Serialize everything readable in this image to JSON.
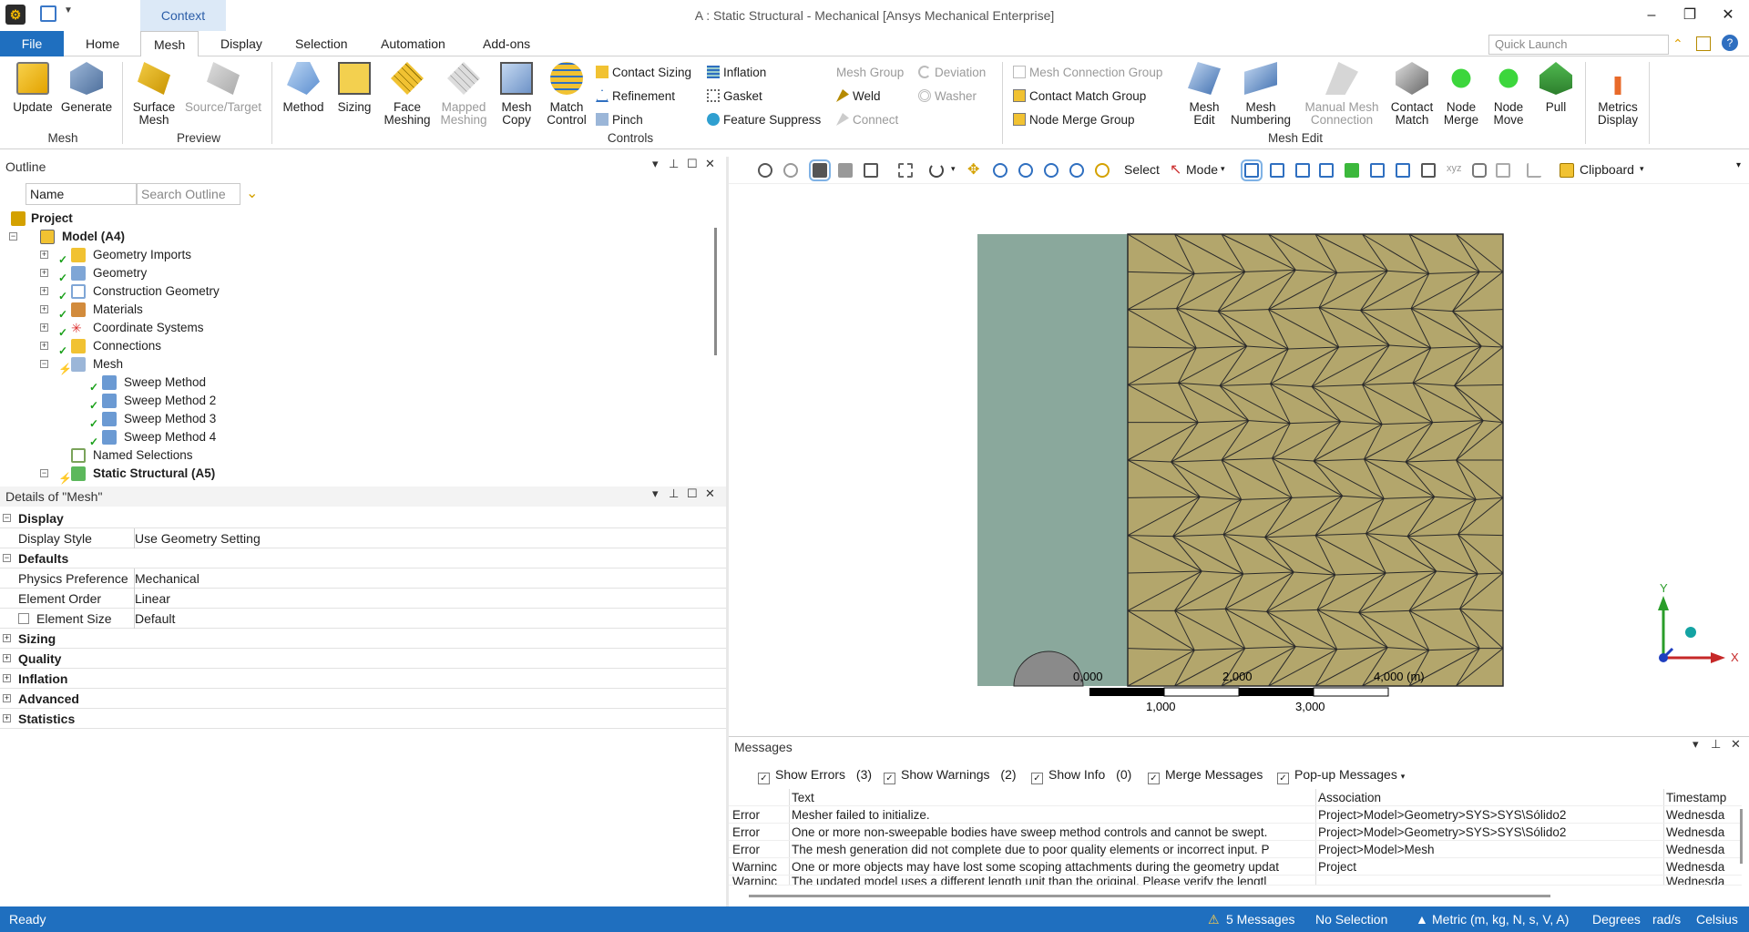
{
  "window": {
    "title": "A : Static Structural - Mechanical [Ansys Mechanical Enterprise]",
    "context_tab": "Context",
    "controls": {
      "minimize": "–",
      "restore": "❐",
      "close": "✕"
    }
  },
  "tabs": {
    "file": "File",
    "home": "Home",
    "mesh": "Mesh",
    "display": "Display",
    "selection": "Selection",
    "automation": "Automation",
    "addons": "Add-ons"
  },
  "quick_launch": {
    "placeholder": "Quick Launch"
  },
  "ribbon": {
    "mesh_group": {
      "label": "Mesh",
      "update": "Update",
      "generate": "Generate"
    },
    "preview_group": {
      "label": "Preview",
      "surface_mesh": "Surface Mesh",
      "source_target": "Source/Target"
    },
    "controls_group": {
      "label": "Controls",
      "method": "Method",
      "sizing": "Sizing",
      "face_meshing": "Face Meshing",
      "mapped_meshing": "Mapped Meshing",
      "mesh_copy": "Mesh Copy",
      "match_control": "Match Control",
      "contact_sizing": "Contact Sizing",
      "refinement": "Refinement",
      "pinch": "Pinch",
      "inflation": "Inflation",
      "gasket": "Gasket",
      "feature_suppress": "Feature Suppress",
      "mesh_group_item": "Mesh Group",
      "weld": "Weld",
      "connect": "Connect",
      "deviation": "Deviation",
      "washer": "Washer"
    },
    "meshedit_group": {
      "label": "Mesh Edit",
      "mesh_connection_group": "Mesh Connection Group",
      "contact_match_group": "Contact Match Group",
      "node_merge_group": "Node Merge Group",
      "mesh_edit": "Mesh Edit",
      "mesh_numbering": "Mesh Numbering",
      "manual_mesh_connection": "Manual Mesh Connection",
      "contact_match": "Contact Match",
      "node_merge": "Node Merge",
      "node_move": "Node Move",
      "pull": "Pull"
    },
    "metrics": {
      "label": "Metrics Display"
    }
  },
  "outline": {
    "title": "Outline",
    "name_filter": "Name",
    "search_placeholder": "Search Outline",
    "tree": [
      {
        "label": "Project",
        "bold": true
      },
      {
        "label": "Model (A4)",
        "bold": true
      },
      {
        "label": "Geometry Imports"
      },
      {
        "label": "Geometry"
      },
      {
        "label": "Construction Geometry"
      },
      {
        "label": "Materials"
      },
      {
        "label": "Coordinate Systems"
      },
      {
        "label": "Connections"
      },
      {
        "label": "Mesh"
      },
      {
        "label": "Sweep Method"
      },
      {
        "label": "Sweep Method 2"
      },
      {
        "label": "Sweep Method 3"
      },
      {
        "label": "Sweep Method 4"
      },
      {
        "label": "Named Selections"
      },
      {
        "label": "Static Structural (A5)",
        "bold": true
      }
    ]
  },
  "details": {
    "title": "Details of \"Mesh\"",
    "sections": {
      "display": "Display",
      "defaults": "Defaults",
      "sizing": "Sizing",
      "quality": "Quality",
      "inflation": "Inflation",
      "advanced": "Advanced",
      "statistics": "Statistics"
    },
    "rows": {
      "display_style": {
        "key": "Display Style",
        "value": "Use Geometry Setting"
      },
      "physics_preference": {
        "key": "Physics Preference",
        "value": "Mechanical"
      },
      "element_order": {
        "key": "Element Order",
        "value": "Linear"
      },
      "element_size": {
        "key": "Element Size",
        "value": "Default"
      }
    }
  },
  "viewport_toolbar": {
    "select": "Select",
    "mode": "Mode",
    "clipboard": "Clipboard"
  },
  "viewport": {
    "scale_top": [
      "0,000",
      "2,000",
      "4,000 (m)"
    ],
    "scale_bottom": [
      "1,000",
      "3,000"
    ],
    "axis_y": "Y",
    "axis_x": "X",
    "colors": {
      "body_left": "#8aa89c",
      "body_mesh": "#b3a66c",
      "mesh_line": "#2a2a2a"
    }
  },
  "messages": {
    "title": "Messages",
    "filters": {
      "show_errors": "Show Errors",
      "errors_count": "(3)",
      "show_warnings": "Show Warnings",
      "warnings_count": "(2)",
      "show_info": "Show Info",
      "info_count": "(0)",
      "merge_messages": "Merge Messages",
      "popup_messages": "Pop-up Messages"
    },
    "columns": {
      "type": "",
      "text": "Text",
      "association": "Association",
      "timestamp": "Timestamp"
    },
    "rows": [
      {
        "type": "Error",
        "text": "Mesher failed to initialize.",
        "association": "Project>Model>Geometry>SYS>SYS\\Sólido2",
        "timestamp": "Wednesda"
      },
      {
        "type": "Error",
        "text": "One or more non-sweepable bodies have sweep method controls and cannot be swept.",
        "association": "Project>Model>Geometry>SYS>SYS\\Sólido2",
        "timestamp": "Wednesda"
      },
      {
        "type": "Error",
        "text": "The mesh generation did not complete due to poor quality elements or incorrect input. P",
        "association": "Project>Model>Mesh",
        "timestamp": "Wednesda"
      },
      {
        "type": "Warninc",
        "text": "One or more objects may have lost some scoping attachments during the geometry updat",
        "association": "Project",
        "timestamp": "Wednesda"
      },
      {
        "type": "Warninc",
        "text": "The updated model uses a different length unit than the original.  Please verify the lengtl",
        "association": "",
        "timestamp": "Wednesda"
      }
    ]
  },
  "status": {
    "ready": "Ready",
    "messages": "5 Messages",
    "selection": "No Selection",
    "units": "Metric (m, kg, N, s, V, A)",
    "angle": "Degrees",
    "rotation": "rad/s",
    "temperature": "Celsius"
  }
}
